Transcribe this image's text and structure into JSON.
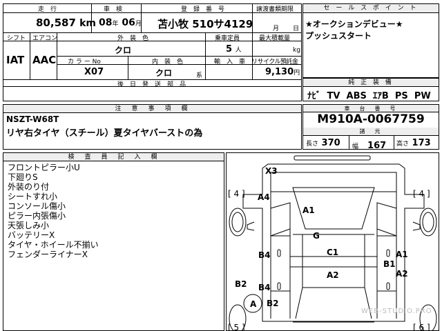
{
  "top": {
    "mileage_label": "走　行",
    "mileage": "80,587",
    "mileage_unit": "km",
    "inspection_label": "車　検",
    "inspection": {
      "year": "08",
      "year_unit": "年",
      "month": "06",
      "month_unit": "月"
    },
    "registration_label": "登　録　番　号",
    "registration": "苫小牧 510サ4129",
    "transfer_label": "譲渡書類期限",
    "transfer_month_unit": "月",
    "transfer_day_unit": "日"
  },
  "row2": {
    "shift_label": "シフト",
    "shift": "IAT",
    "ac_label": "エアコン",
    "ac": "AAC",
    "ext_color_label": "外　装　色",
    "ext_color": "クロ",
    "capacity_label": "乗車定員",
    "capacity": "5",
    "capacity_unit": "人",
    "max_load_label": "最大積載量",
    "max_load_unit": "kg",
    "color_no_label": "カ ラ ー No",
    "color_no": "X07",
    "int_color_label": "内　装　色",
    "int_color": "クロ",
    "int_color_unit": "系",
    "import_label": "輸　入　車",
    "recycle_label": "リサイクル預託金",
    "recycle": "9,130",
    "recycle_unit": "円"
  },
  "accessories_label": "後　日　発　送　部　品",
  "sales_point": {
    "label": "セ ー ル ス ポ イ ン ト",
    "lines": [
      "★オークションデビュー★",
      "プッシュスタート"
    ]
  },
  "equipment": {
    "label": "純 正 装 備",
    "items": "ﾅﾋﾞ  TV  ABS  ｴｱB  PS  PW"
  },
  "notes": {
    "label": "注　意　事　項　欄",
    "lines": [
      "NSZT-W68T",
      "リヤ右タイヤ（スチール）夏タイヤバーストの為"
    ]
  },
  "chassis": {
    "label": "車　台　番　号",
    "value": "M910A-0067759",
    "dims_label": "諸　元",
    "length_label": "長さ",
    "length": "370",
    "width_label": "幅",
    "width": "167",
    "height_label": "高さ",
    "height": "173"
  },
  "inspector": {
    "label": "検　査　員　記　入　欄",
    "lines": [
      "フロントピラー小U",
      "下廻りS",
      "外装のり付",
      "シートすれ小",
      "コンソール傷小",
      "ピラー内張傷小",
      "天張しみ小",
      "バッテリーX",
      "タイヤ・ホイール不揃い",
      "フェンダーライナーX"
    ]
  },
  "diagram": {
    "marks": [
      "X3",
      "A4",
      "A1",
      "G",
      "C1",
      "A2",
      "B4",
      "B4",
      "B2",
      "B2",
      "A",
      "A1",
      "B1",
      "A2"
    ],
    "tire_labels": [
      "[ 4 ]",
      "[ 4 ]",
      "[ 5 ]",
      "[ 6 ]"
    ]
  },
  "watermark": "WEB-STUDIO.PRO"
}
